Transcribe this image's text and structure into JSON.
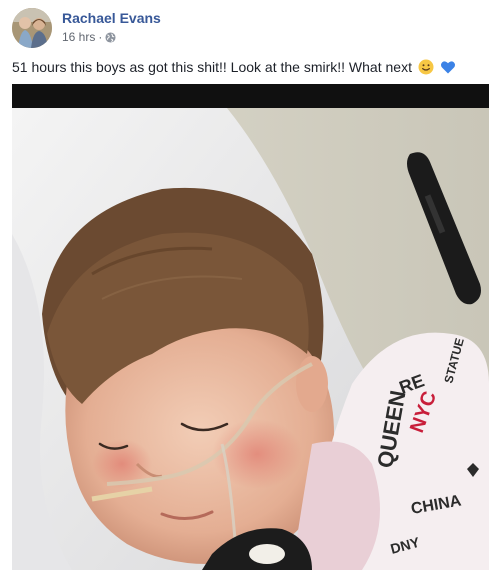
{
  "post": {
    "author": "Rachael Evans",
    "time": "16 hrs",
    "separator": "·",
    "privacy_icon": "globe-icon",
    "text": "51 hours this boys as got this shit!! Look at the smirk!! What next",
    "emojis": [
      "slightly-smiling-face-icon",
      "blue-heart-icon"
    ]
  },
  "photo": {
    "alt": "Photo of a sleeping toddler in a hospital bed"
  },
  "colors": {
    "author_link": "#385898",
    "meta_text": "#616770",
    "body_text": "#1d2129"
  }
}
